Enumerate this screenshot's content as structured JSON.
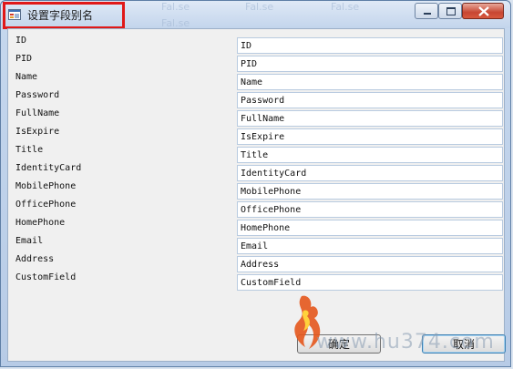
{
  "window": {
    "title": "设置字段别名"
  },
  "background_ghost": [
    "Fal.se",
    "Fal.se",
    "Fal.se",
    "Fal.se"
  ],
  "labels": [
    "ID",
    "PID",
    "Name",
    "Password",
    "FullName",
    "IsExpire",
    "Title",
    "IdentityCard",
    "MobilePhone",
    "OfficePhone",
    "HomePhone",
    "Email",
    "Address",
    "CustomField"
  ],
  "fields": [
    "ID",
    "PID",
    "Name",
    "Password",
    "FullName",
    "IsExpire",
    "Title",
    "IdentityCard",
    "MobilePhone",
    "OfficePhone",
    "HomePhone",
    "Email",
    "Address",
    "CustomField"
  ],
  "buttons": {
    "ok_label": "确定",
    "cancel_label": "取消"
  },
  "watermark": {
    "text": "www.hu374.com"
  },
  "colors": {
    "highlight": "#e01818",
    "client_bg": "#f0f0f0",
    "frame": "#c6d8ee"
  }
}
